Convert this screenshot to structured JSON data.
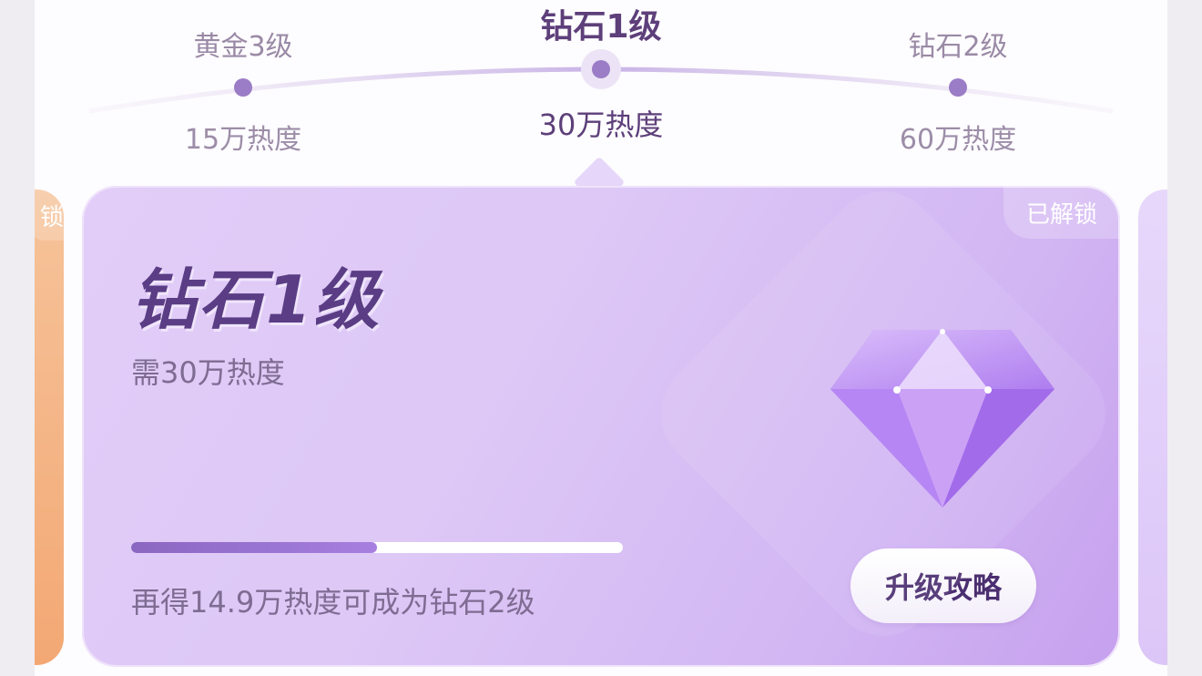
{
  "levels": [
    {
      "name": "黄金3级",
      "heat": "15万热度",
      "active": false
    },
    {
      "name": "钻石1级",
      "heat": "30万热度",
      "active": true
    },
    {
      "name": "钻石2级",
      "heat": "60万热度",
      "active": false
    }
  ],
  "card": {
    "title": "钻石1级",
    "requirement": "需30万热度",
    "status_badge": "已解锁",
    "progress_fraction": 0.5,
    "hint": "再得14.9万热度可成为钻石2级",
    "button_label": "升级攻略",
    "icon": "diamond-icon"
  },
  "side_cards": {
    "left_partial_text": "锁"
  },
  "colors": {
    "accent": "#5d3f7a",
    "card": "#d8c0f5",
    "progress": "#8a67c1"
  }
}
